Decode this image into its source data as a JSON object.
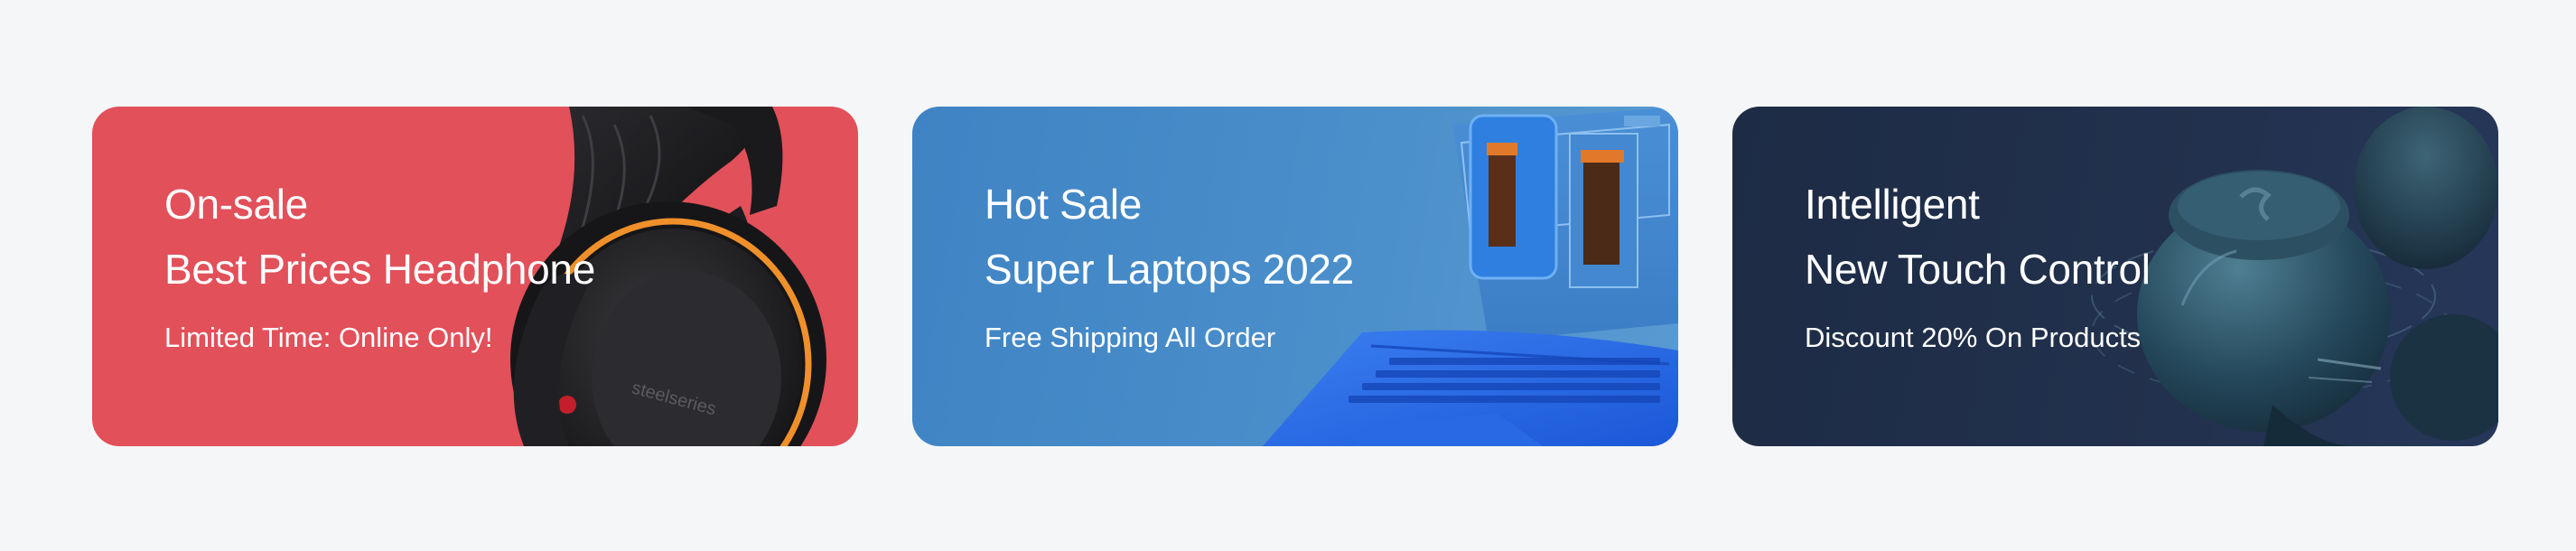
{
  "banners": [
    {
      "title_line1": "On-sale",
      "title_line2": "Best Prices Headphone",
      "subtitle": "Limited Time: Online Only!",
      "background": "#e2505a",
      "image_icon": "headphone-image"
    },
    {
      "title_line1": "Hot Sale",
      "title_line2": "Super Laptops 2022",
      "subtitle": "Free Shipping All Order",
      "background": "#3f83c4",
      "image_icon": "laptop-image"
    },
    {
      "title_line1": "Intelligent",
      "title_line2": "New Touch Control",
      "subtitle": "Discount 20% On Products",
      "background": "#1d2b45",
      "image_icon": "earbuds-image"
    }
  ]
}
